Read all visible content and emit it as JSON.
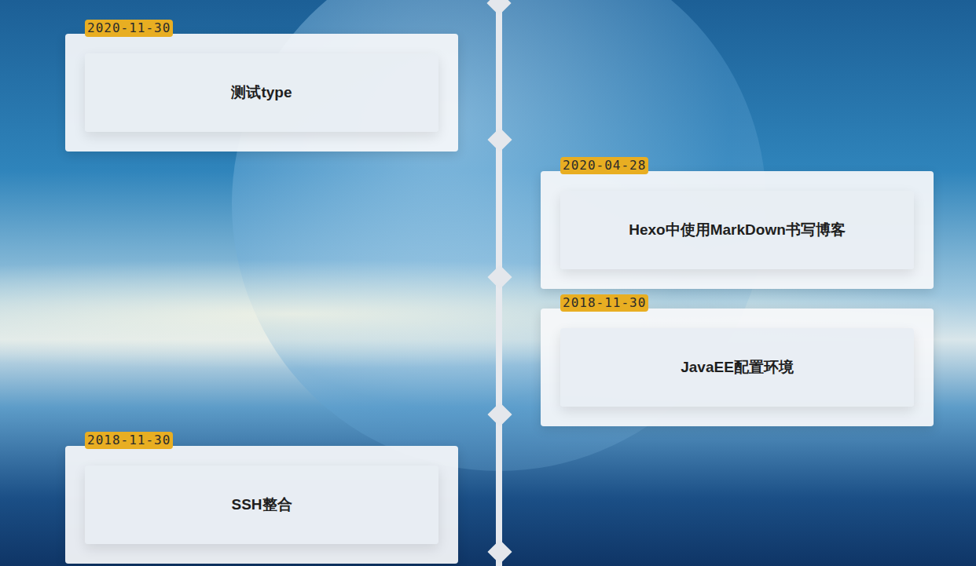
{
  "timeline": [
    {
      "date": "2020-11-30",
      "title": "测试type",
      "kind": "left"
    },
    {
      "date": "2020-04-28",
      "title": "Hexo中使用MarkDown书写博客",
      "kind": "right"
    },
    {
      "date": "2018-11-30",
      "title": "JavaEE配置环境",
      "kind": "right"
    },
    {
      "date": "2018-11-30",
      "title": "SSH整合",
      "kind": "left"
    }
  ]
}
